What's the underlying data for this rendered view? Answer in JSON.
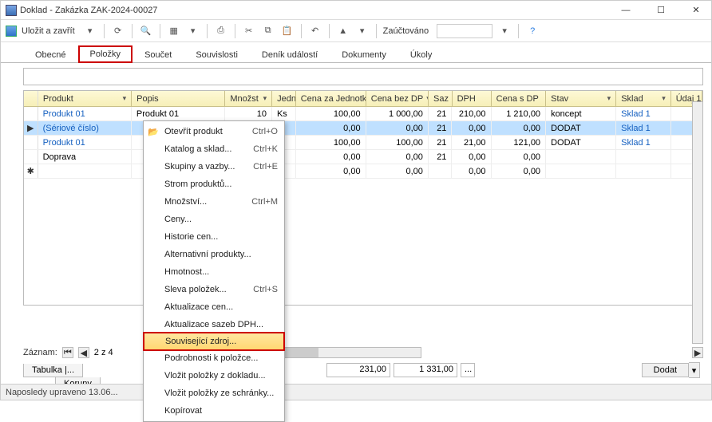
{
  "window": {
    "title": "Doklad - Zakázka ZAK-2024-00027"
  },
  "toolbar": {
    "save_label": "Uložit a zavřít",
    "posted_label": "Zaúčtováno"
  },
  "tabs": {
    "items": [
      {
        "label": "Obecné"
      },
      {
        "label": "Položky"
      },
      {
        "label": "Součet"
      },
      {
        "label": "Souvislosti"
      },
      {
        "label": "Deník událostí"
      },
      {
        "label": "Dokumenty"
      },
      {
        "label": "Úkoly"
      }
    ],
    "active_index": 1
  },
  "grid": {
    "columns": [
      "Produkt",
      "Popis",
      "Množst",
      "Jedn",
      "Cena za Jednotku",
      "Cena bez DP",
      "Saz",
      "DPH",
      "Cena s DP",
      "Stav",
      "Sklad",
      "Údaj 1"
    ],
    "rows": [
      {
        "produkt": "Produkt 01",
        "popis": "Produkt 01",
        "mnoz": "10",
        "jedn": "Ks",
        "cj": "100,00",
        "cbdph": "1 000,00",
        "saz": "21",
        "dph": "210,00",
        "csdph": "1 210,00",
        "stav": "koncept",
        "sklad": "Sklad 1",
        "udaj": ""
      },
      {
        "produkt": "(Sériové číslo)",
        "popis": "",
        "mnoz": "",
        "jedn": "",
        "cj": "0,00",
        "cbdph": "0,00",
        "saz": "21",
        "dph": "0,00",
        "csdph": "0,00",
        "stav": "DODAT",
        "sklad": "Sklad 1",
        "udaj": ""
      },
      {
        "produkt": "Produkt 01",
        "popis": "",
        "mnoz": "",
        "jedn": "",
        "cj": "100,00",
        "cbdph": "100,00",
        "saz": "21",
        "dph": "21,00",
        "csdph": "121,00",
        "stav": "DODAT",
        "sklad": "Sklad 1",
        "udaj": ""
      },
      {
        "produkt": "Doprava",
        "popis": "",
        "mnoz": "",
        "jedn": "",
        "cj": "0,00",
        "cbdph": "0,00",
        "saz": "21",
        "dph": "0,00",
        "csdph": "0,00",
        "stav": "",
        "sklad": "",
        "udaj": ""
      },
      {
        "produkt": "",
        "popis": "",
        "mnoz": "",
        "jedn": "",
        "cj": "0,00",
        "cbdph": "0,00",
        "saz": "",
        "dph": "0,00",
        "csdph": "0,00",
        "stav": "",
        "sklad": "",
        "udaj": ""
      }
    ],
    "selected_index": 1
  },
  "context_menu": {
    "items": [
      {
        "label": "Otevřít produkt",
        "shortcut": "Ctrl+O",
        "icon": "folder"
      },
      {
        "label": "Katalog a sklad...",
        "shortcut": "Ctrl+K"
      },
      {
        "label": "Skupiny a vazby...",
        "shortcut": "Ctrl+E"
      },
      {
        "label": "Strom produktů..."
      },
      {
        "label": "Množství...",
        "shortcut": "Ctrl+M"
      },
      {
        "label": "Ceny..."
      },
      {
        "label": "Historie cen..."
      },
      {
        "label": "Alternativní produkty..."
      },
      {
        "label": "Hmotnost..."
      },
      {
        "label": "Sleva položek...",
        "shortcut": "Ctrl+S"
      },
      {
        "label": "Aktualizace cen..."
      },
      {
        "label": "Aktualizace sazeb DPH..."
      },
      {
        "label": "Související zdroj...",
        "highlight": true
      },
      {
        "label": "Podrobnosti k položce..."
      },
      {
        "label": "Vložit položky z dokladu..."
      },
      {
        "label": "Vložit položky ze schránky..."
      },
      {
        "label": "Kopírovat"
      }
    ]
  },
  "footer": {
    "record_label": "Záznam:",
    "record_pos": "2 z 4",
    "bottom_tabs": [
      "Tabulka  |...",
      "Koruny"
    ],
    "total1": "231,00",
    "total2": "1 331,00",
    "add_button": "Dodat",
    "totals_more": "..."
  },
  "status": {
    "text": "Naposledy upraveno 13.06..."
  }
}
